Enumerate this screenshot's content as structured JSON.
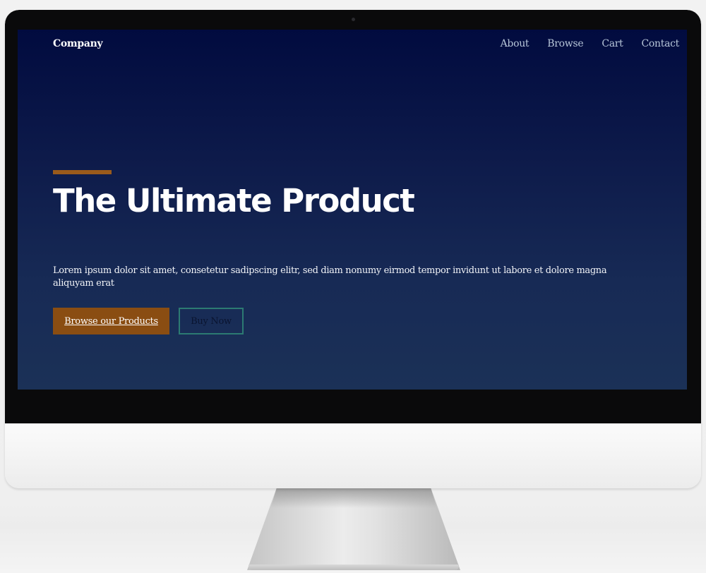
{
  "site": {
    "brand": "Company",
    "nav": [
      "About",
      "Browse",
      "Cart",
      "Contact"
    ]
  },
  "hero": {
    "headline": "The Ultimate Product",
    "lead": "Lorem ipsum dolor sit amet, consetetur sadipscing elitr, sed diam nonumy eirmod tempor invidunt ut labore et dolore magna aliquyam erat",
    "primary_button": "Browse our Products",
    "secondary_button": "Buy Now"
  },
  "colors": {
    "screen_top": "#010b3f",
    "screen_bottom": "#1b3157",
    "accent": "#8a4d12",
    "outline": "#2c7a72",
    "nav_text": "#b7c5d8"
  }
}
